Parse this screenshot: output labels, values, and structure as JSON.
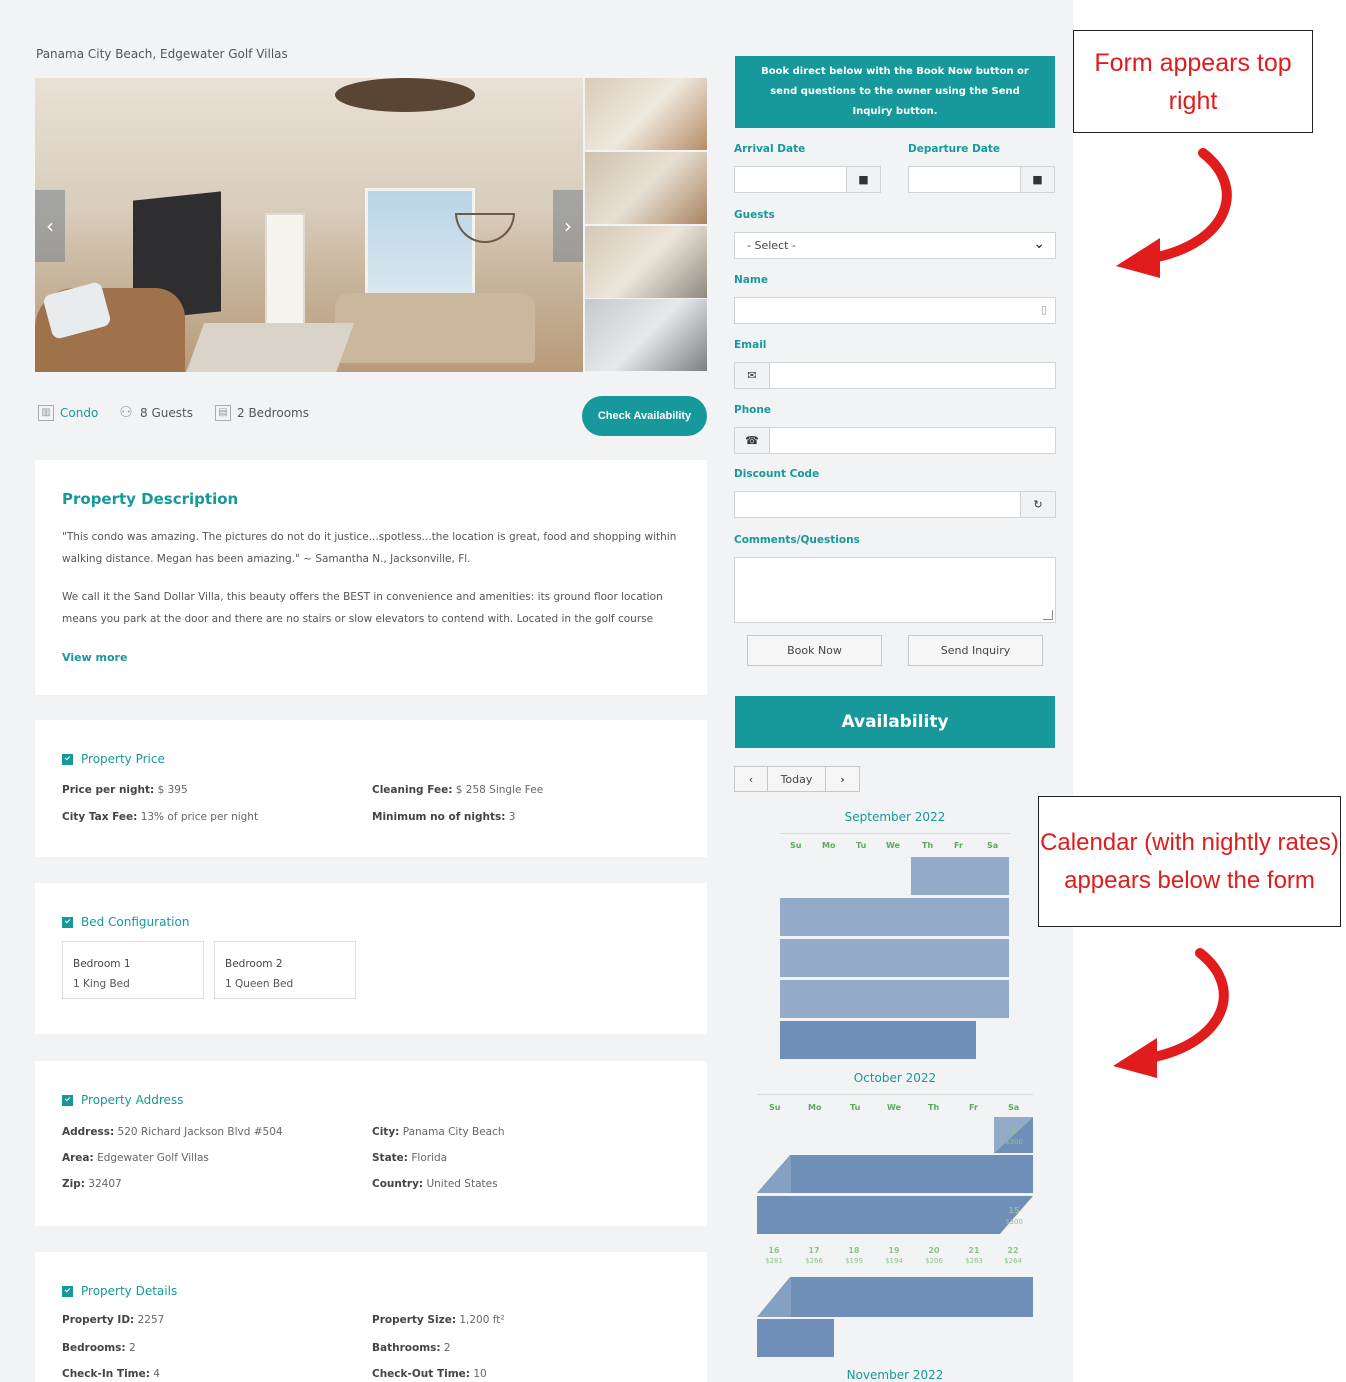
{
  "location": "Panama City Beach, Edgewater Golf Villas",
  "features": {
    "type": "Condo",
    "guests": "8 Guests",
    "bedrooms": "2 Bedrooms",
    "check_btn": "Check Availability"
  },
  "description": {
    "title": "Property Description",
    "p1": "\"This condo was amazing. The pictures do not do it justice...spotless...the location is great, food and shopping within walking distance. Megan has been amazing.\" ~ Samantha N., Jacksonville, Fl.",
    "p2": "We call it the Sand Dollar Villa, this beauty offers the BEST in convenience and amenities: its ground floor location means you park at the door and there are no stairs or slow elevators to contend with. Located in the golf course",
    "view_more": "View more"
  },
  "price": {
    "title": "Property Price",
    "per_night_label": "Price per night:",
    "per_night": "$ 395",
    "tax_label": "City Tax Fee:",
    "tax": "13% of price per night",
    "cleaning_label": "Cleaning Fee:",
    "cleaning": "$ 258 Single Fee",
    "min_label": "Minimum no of nights:",
    "min": "3"
  },
  "beds": {
    "title": "Bed Configuration",
    "items": [
      {
        "name": "Bedroom 1",
        "bed": "1 King Bed"
      },
      {
        "name": "Bedroom 2",
        "bed": "1 Queen Bed"
      }
    ]
  },
  "address": {
    "title": "Property Address",
    "address_label": "Address:",
    "address": "520 Richard Jackson Blvd #504",
    "area_label": "Area:",
    "area": "Edgewater Golf Villas",
    "zip_label": "Zip:",
    "zip": "32407",
    "city_label": "City:",
    "city": "Panama City Beach",
    "state_label": "State:",
    "state": "Florida",
    "country_label": "Country:",
    "country": "United States"
  },
  "details": {
    "title": "Property Details",
    "id_label": "Property ID:",
    "id": "2257",
    "bedrooms_label": "Bedrooms:",
    "bedrooms": "2",
    "checkin_label": "Check-In Time:",
    "checkin": "4",
    "size_label": "Property Size:",
    "size": "1,200 ft²",
    "bathrooms_label": "Bathrooms:",
    "bathrooms": "2",
    "checkout_label": "Check-Out Time:",
    "checkout": "10"
  },
  "form": {
    "banner": "Book direct below with the Book Now button or send questions to the owner using the Send Inquiry button.",
    "arrival_label": "Arrival Date",
    "departure_label": "Departure Date",
    "guests_label": "Guests",
    "guests_value": "- Select -",
    "name_label": "Name",
    "email_label": "Email",
    "phone_label": "Phone",
    "discount_label": "Discount Code",
    "comments_label": "Comments/Questions",
    "book_now": "Book Now",
    "send_inquiry": "Send Inquiry"
  },
  "availability": {
    "title": "Availability",
    "today": "Today",
    "months": [
      "September 2022",
      "October 2022",
      "November 2022"
    ],
    "dow": [
      "Su",
      "Mo",
      "Tu",
      "We",
      "Th",
      "Fr",
      "Sa"
    ],
    "oct_row_days": [
      "16",
      "17",
      "18",
      "19",
      "20",
      "21",
      "22"
    ],
    "oct_row_rates": [
      "$281",
      "$266",
      "$199",
      "$194",
      "$206",
      "$263",
      "$264"
    ],
    "oct_first": "1",
    "oct_first_rate": "$300",
    "oct_15": "15",
    "oct_15_rate": "$300"
  },
  "annotations": {
    "top": "Form appears top right",
    "bottom": "Calendar (with nightly rates) appears below the form"
  },
  "colors": {
    "accent": "#17989a",
    "calendar_available": "#93abc9",
    "calendar_booked": "#6f8fb8",
    "annotation": "#e01c1c"
  }
}
